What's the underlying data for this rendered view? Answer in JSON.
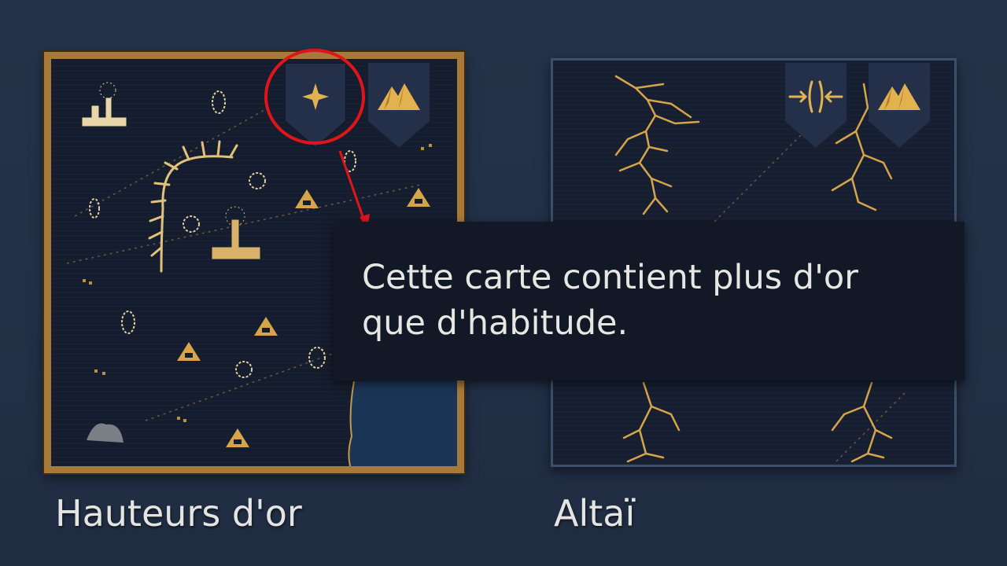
{
  "maps": [
    {
      "name": "Hauteurs d'or",
      "selected": true,
      "badges": [
        "plus-gold-icon",
        "mountains-icon"
      ]
    },
    {
      "name": "Altaï",
      "selected": false,
      "badges": [
        "compress-arrows-icon",
        "mountains-icon"
      ]
    }
  ],
  "tooltip": {
    "line1": "Cette carte contient plus d'or",
    "line2": "que d'habitude."
  },
  "colors": {
    "background": "#243349",
    "gold": "#d6a54a",
    "frame_gold": "#a87a3a",
    "frame_blue": "#3b4e6b",
    "tooltip_bg": "#121826",
    "annotation_red": "#e0151b"
  }
}
